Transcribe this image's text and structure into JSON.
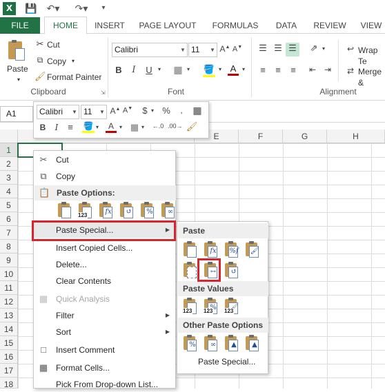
{
  "ribbon_tabs": {
    "file": "FILE",
    "home": "HOME",
    "insert": "INSERT",
    "page_layout": "PAGE LAYOUT",
    "formulas": "FORMULAS",
    "data": "DATA",
    "review": "REVIEW",
    "view": "VIEW"
  },
  "clipboard": {
    "paste": "Paste",
    "cut": "Cut",
    "copy": "Copy",
    "format_painter": "Format Painter",
    "group": "Clipboard"
  },
  "font": {
    "name": "Calibri",
    "size": "11",
    "group": "Font"
  },
  "alignment": {
    "wrap_text": "Wrap Te",
    "merge": "Merge &",
    "group": "Alignment"
  },
  "name_box": "A1",
  "mini_toolbar": {
    "font": "Calibri",
    "size": "11"
  },
  "columns": [
    "E",
    "F",
    "G",
    "H"
  ],
  "rows": [
    "1",
    "2",
    "3",
    "4",
    "5",
    "6",
    "7",
    "8",
    "9",
    "10",
    "11",
    "12",
    "13",
    "14",
    "15",
    "16",
    "17",
    "18"
  ],
  "context_menu": {
    "cut": "Cut",
    "copy": "Copy",
    "paste_options": "Paste Options:",
    "paste_special": "Paste Special...",
    "insert_copied": "Insert Copied Cells...",
    "delete": "Delete...",
    "clear": "Clear Contents",
    "quick_analysis": "Quick Analysis",
    "filter": "Filter",
    "sort": "Sort",
    "insert_comment": "Insert Comment",
    "format_cells": "Format Cells...",
    "pick_list": "Pick From Drop-down List..."
  },
  "submenu": {
    "paste": "Paste",
    "paste_values": "Paste Values",
    "other": "Other Paste Options",
    "paste_special": "Paste Special..."
  },
  "colors": {
    "excel_green": "#217346",
    "highlight_red": "#d9232d",
    "font_red": "#c00000",
    "fill_yellow": "#ffff00"
  }
}
